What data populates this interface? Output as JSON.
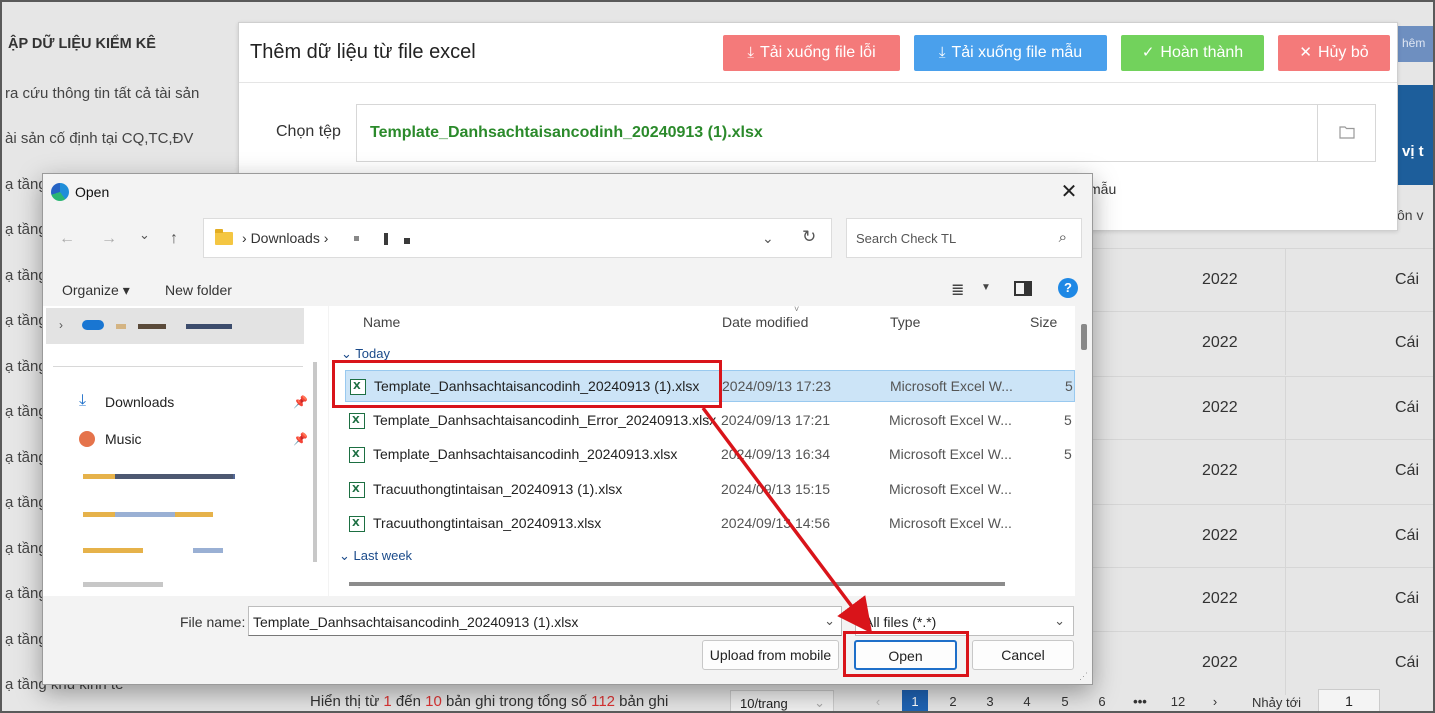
{
  "background": {
    "sidebar_title": "ẬP DỮ LIỆU KIỂM KÊ",
    "sidebar_items": [
      "ra cứu thông tin tất cả tài sản",
      "ài sản cố định tại CQ,TC,ĐV",
      "ạ tầng",
      "ạ tầng",
      "ạ tầng",
      "ạ tầng",
      "ạ tầng",
      "ạ tầng",
      "ạ tầng",
      "ạ tầng",
      "ạ tầng",
      "ạ tầng",
      "ạ tầng",
      "ạ tầng khu kinh tế"
    ],
    "table_rows": [
      {
        "year": "2022",
        "unit": "Cái"
      },
      {
        "year": "2022",
        "unit": "Cái"
      },
      {
        "year": "2022",
        "unit": "Cái"
      },
      {
        "year": "2022",
        "unit": "Cái"
      },
      {
        "year": "2022",
        "unit": "Cái"
      },
      {
        "year": "2022",
        "unit": "Cái"
      },
      {
        "year": "2022",
        "unit": "Cái"
      }
    ],
    "right_col_head": "vị t",
    "right_top_btn": "hêm",
    "right_sub": "ôn v",
    "pagination": {
      "summary_prefix": "Hiển thị từ ",
      "from": "1",
      "mid1": " đến ",
      "to": "10",
      "mid2": " bản ghi trong tổng số ",
      "total": "112",
      "suffix": " bản ghi",
      "page_size": "10/trang",
      "pages": [
        "1",
        "2",
        "3",
        "4",
        "5",
        "6",
        "•••",
        "12"
      ],
      "prev": "‹",
      "next": "›",
      "jump_label": "Nhảy tới",
      "jump_value": "1"
    }
  },
  "import_panel": {
    "title": "Thêm dữ liệu từ file excel",
    "btn_error": "Tải xuống file lỗi",
    "btn_template": "Tải xuống file mẫu",
    "btn_done": "Hoàn thành",
    "btn_cancel": "Hủy bỏ",
    "file_label": "Chọn tệp",
    "file_value": "Template_Danhsachtaisancodinh_20240913 (1).xlsx",
    "note_tail": "mẫu"
  },
  "open_dialog": {
    "title": "Open",
    "close": "✕",
    "nav": {
      "back": "←",
      "forward": "→",
      "recent": "⌄",
      "up": "↑"
    },
    "address": "Downloads",
    "search_placeholder": "Search Check TL",
    "organize": "Organize ▾",
    "new_folder": "New folder",
    "nav_pane": {
      "downloads": "Downloads",
      "music": "Music"
    },
    "columns": {
      "name": "Name",
      "date": "Date modified",
      "type": "Type",
      "size": "Size"
    },
    "group_today": "Today",
    "group_lastweek": "Last week",
    "files": [
      {
        "name": "Template_Danhsachtaisancodinh_20240913 (1).xlsx",
        "date": "2024/09/13 17:23",
        "type": "Microsoft Excel W...",
        "size": "5"
      },
      {
        "name": "Template_Danhsachtaisancodinh_Error_20240913.xlsx",
        "date": "2024/09/13 17:21",
        "type": "Microsoft Excel W...",
        "size": "5"
      },
      {
        "name": "Template_Danhsachtaisancodinh_20240913.xlsx",
        "date": "2024/09/13 16:34",
        "type": "Microsoft Excel W...",
        "size": "5"
      },
      {
        "name": "Tracuuthongtintaisan_20240913 (1).xlsx",
        "date": "2024/09/13 15:15",
        "type": "Microsoft Excel W...",
        "size": ""
      },
      {
        "name": "Tracuuthongtintaisan_20240913.xlsx",
        "date": "2024/09/13 14:56",
        "type": "Microsoft Excel W...",
        "size": ""
      }
    ],
    "file_name_label": "File name:",
    "file_name_value": "Template_Danhsachtaisancodinh_20240913 (1).xlsx",
    "filter_value": "All files (*.*)",
    "btn_upload": "Upload from mobile",
    "btn_open": "Open",
    "btn_cancel": "Cancel"
  },
  "colors": {
    "annotation_red": "#d9141a",
    "btn_red": "#f47a7a",
    "btn_blue": "#4aa0ec",
    "btn_green": "#72d25c",
    "selected_row": "#cce4f7",
    "file_green": "#2b8a2b"
  }
}
